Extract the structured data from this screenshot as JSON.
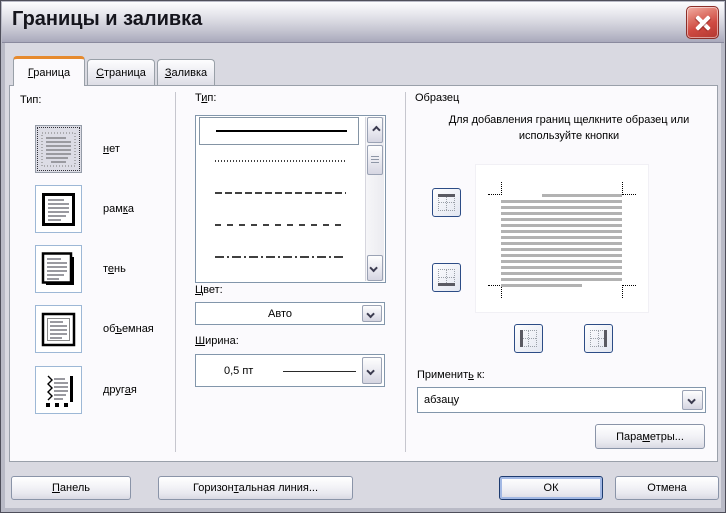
{
  "window": {
    "title": "Границы и заливка"
  },
  "tabs": [
    {
      "pre": "",
      "key": "Г",
      "post": "раница",
      "active": true
    },
    {
      "pre": "",
      "key": "С",
      "post": "траница",
      "active": false
    },
    {
      "pre": "",
      "key": "З",
      "post": "аливка",
      "active": false
    }
  ],
  "left": {
    "label": "Тип:",
    "options": [
      {
        "pre": "",
        "key": "н",
        "post": "ет",
        "icon": "border-none-icon",
        "selected": true
      },
      {
        "pre": "рам",
        "key": "к",
        "post": "а",
        "icon": "border-box-icon",
        "selected": false
      },
      {
        "pre": "т",
        "key": "е",
        "post": "нь",
        "icon": "border-shadow-icon",
        "selected": false
      },
      {
        "pre": "об",
        "key": "ъ",
        "post": "емная",
        "icon": "border-3d-icon",
        "selected": false
      },
      {
        "pre": "друг",
        "key": "а",
        "post": "я",
        "icon": "border-custom-icon",
        "selected": false
      }
    ]
  },
  "middle": {
    "label_pre": "Т",
    "label_key": "и",
    "label_post": "п:",
    "line_style_options": [
      "solid",
      "dotted",
      "dashed",
      "dash-spaced",
      "dash-dot"
    ],
    "selected_line_style": "solid",
    "color": {
      "label_pre": "",
      "label_key": "Ц",
      "label_post": "вет:",
      "value": "Авто"
    },
    "width": {
      "label_pre": "",
      "label_key": "Ш",
      "label_post": "ирина:",
      "value": "0,5 пт"
    }
  },
  "sample": {
    "label": "Образец",
    "instruction": "Для добавления границ щелкните образец или используйте кнопки",
    "border_buttons": [
      "top-border",
      "bottom-border",
      "left-border",
      "right-border"
    ],
    "preview_line_count": 16,
    "apply": {
      "label_pre": "Применит",
      "label_key": "ь",
      "label_post": " к:",
      "value": "абзацу"
    },
    "params_button": {
      "pre": "Пара",
      "key": "м",
      "post": "етры..."
    }
  },
  "footer": {
    "panel_button": {
      "pre": "",
      "key": "П",
      "post": "анель"
    },
    "hline_button": {
      "pre": "Горизон",
      "key": "т",
      "post": "альная линия..."
    },
    "ok_button": "ОК",
    "cancel_button": "Отмена"
  },
  "colors": {
    "active_tab_accent": "#e68a2e",
    "close_button": "#cf4a42",
    "control_border": "#8296ab",
    "paragraph_line": "#b2b2b2"
  }
}
